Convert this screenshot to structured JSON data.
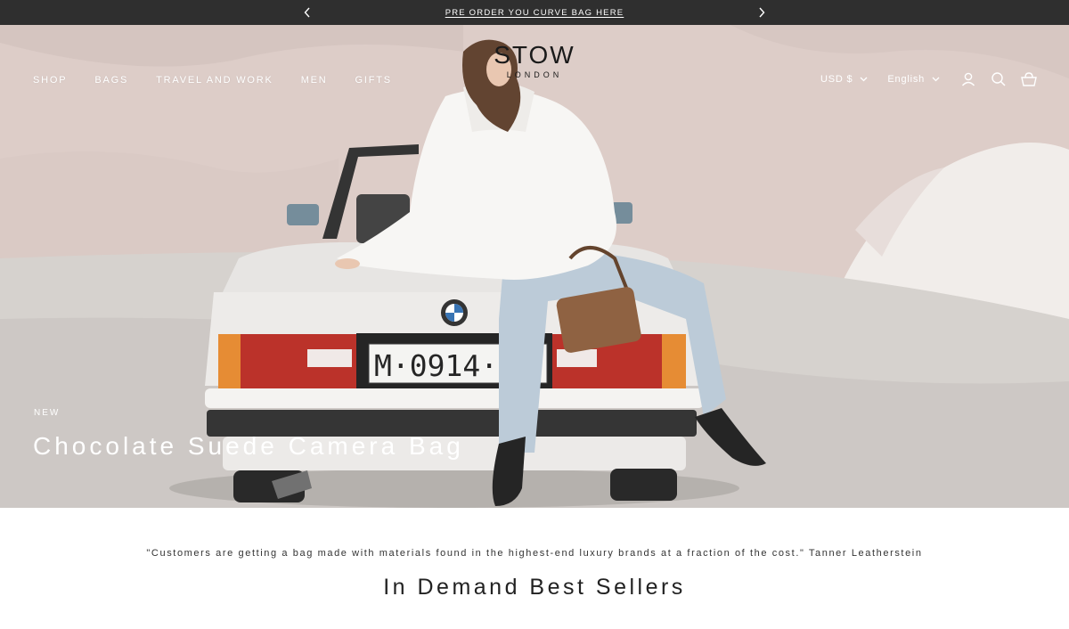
{
  "announcement": {
    "text": "PRE ORDER YOU CURVE BAG HERE",
    "prev_icon": "chevron-left-icon",
    "next_icon": "chevron-right-icon"
  },
  "header": {
    "logo_main": "STOW",
    "logo_sub": "LONDON",
    "nav": [
      "SHOP",
      "BAGS",
      "TRAVEL AND WORK",
      "MEN",
      "GIFTS"
    ],
    "currency": "USD $",
    "language": "English",
    "icons": [
      "account-icon",
      "search-icon",
      "cart-icon"
    ]
  },
  "hero": {
    "eyebrow": "NEW",
    "title": "Chocolate Suede Camera Bag",
    "plate_text": "M·0914·C"
  },
  "quote": "\"Customers are getting a bag made with materials found in the highest-end luxury brands at a fraction of the cost.\" Tanner Leatherstein",
  "section_title": "In Demand Best Sellers",
  "colors": {
    "announcement_bg": "#2f2f2f",
    "nav_text": "#ffffff",
    "logo": "#1a1a1a"
  }
}
